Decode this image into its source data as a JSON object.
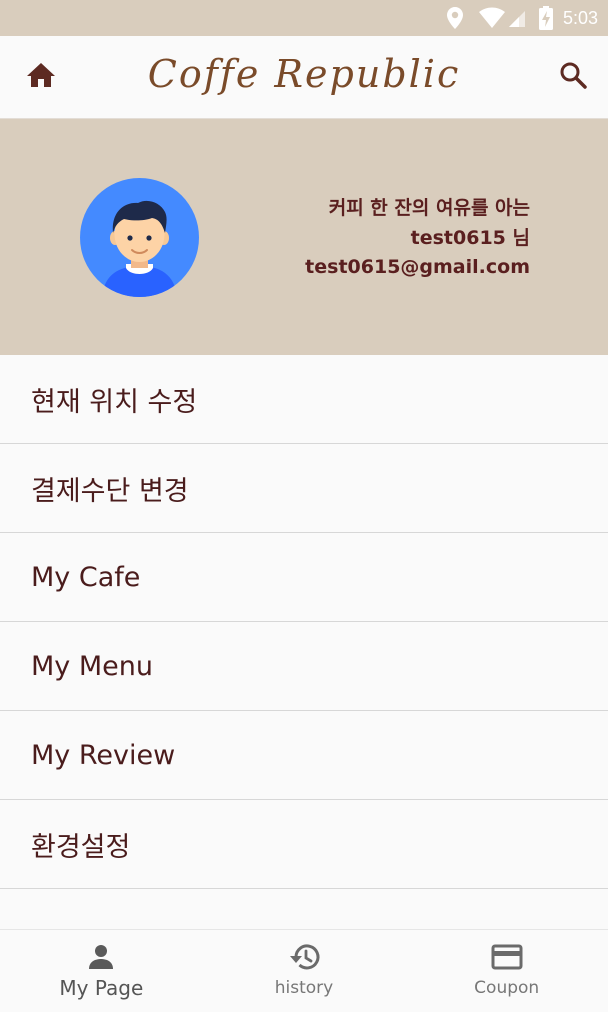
{
  "status_bar": {
    "time": "5:03",
    "icons": [
      "location-icon",
      "wifi-icon",
      "signal-icon",
      "battery-charging-icon"
    ]
  },
  "app_bar": {
    "title": "Coffe Republic",
    "left_icon": "home-icon",
    "right_icon": "search-icon"
  },
  "profile": {
    "tagline": "커피 한 잔의 여유를 아는",
    "username": "test0615 님",
    "email": "test0615@gmail.com",
    "avatar": "user-avatar"
  },
  "menu": {
    "items": [
      {
        "label": "현재 위치 수정"
      },
      {
        "label": "결제수단 변경"
      },
      {
        "label": "My Cafe"
      },
      {
        "label": "My Menu"
      },
      {
        "label": "My Review"
      },
      {
        "label": "환경설정"
      }
    ]
  },
  "bottom_nav": {
    "items": [
      {
        "label": "My Page",
        "icon": "person-icon",
        "active": true
      },
      {
        "label": "history",
        "icon": "history-icon",
        "active": false
      },
      {
        "label": "Coupon",
        "icon": "credit-card-icon",
        "active": false
      }
    ]
  },
  "colors": {
    "beige": "#d9cdbd",
    "brown_text": "#5a1f1f",
    "logo_brown": "#7a4b2a",
    "avatar_blue": "#448aff"
  }
}
